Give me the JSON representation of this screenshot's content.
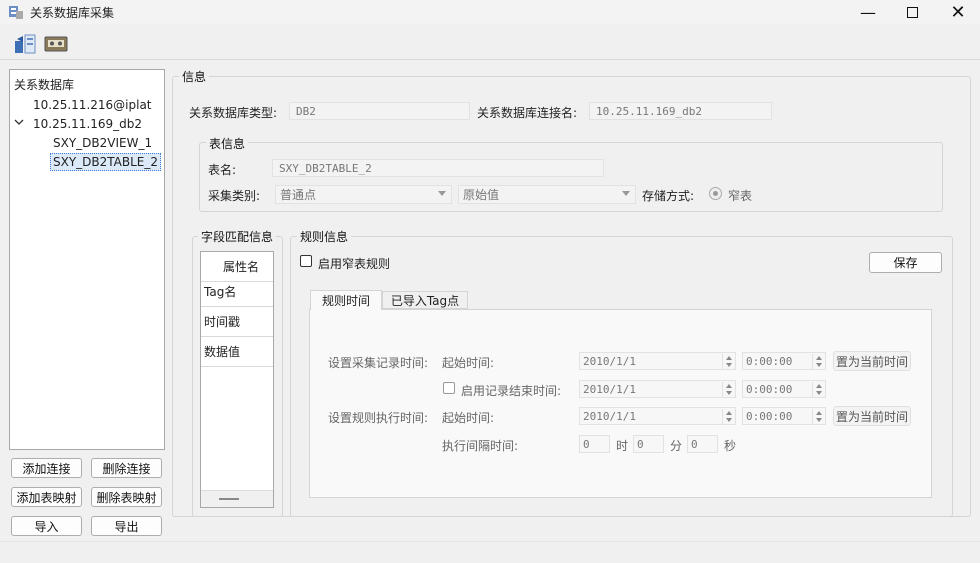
{
  "window": {
    "title": "关系数据库采集"
  },
  "toolbar": {
    "icons": [
      "database-export-icon",
      "tape-cassette-icon"
    ]
  },
  "tree": {
    "root": "关系数据库",
    "items": [
      {
        "label": "10.25.11.216@iplat",
        "expanded": false
      },
      {
        "label": "10.25.11.169_db2",
        "expanded": true
      },
      {
        "label": "SXY_DB2VIEW_1"
      },
      {
        "label": "SXY_DB2TABLE_2",
        "selected": true
      }
    ],
    "expand_glyph": "v"
  },
  "left_buttons": [
    "添加连接",
    "删除连接",
    "添加表映射",
    "删除表映射",
    "导入",
    "导出"
  ],
  "info": {
    "title": "信息",
    "db_type_label": "关系数据库类型:",
    "db_type_value": "DB2",
    "conn_name_label": "关系数据库连接名:",
    "conn_name_value": "10.25.11.169_db2",
    "table_info": {
      "title": "表信息",
      "table_name_label": "表名:",
      "table_name_value": "SXY_DB2TABLE_2",
      "collect_type_label": "采集类别:",
      "collect_type_value": "普通点",
      "value_type_value": "原始值",
      "storage_label": "存储方式:",
      "storage_option": "窄表"
    }
  },
  "field_match": {
    "title": "字段匹配信息",
    "header": "属性名",
    "rows": [
      "Tag名",
      "时间戳",
      "数据值"
    ]
  },
  "rule": {
    "title": "规则信息",
    "enable_label": "启用窄表规则",
    "save_label": "保存",
    "tabs": [
      "规则时间",
      "已导入Tag点"
    ],
    "collect_time_label": "设置采集记录时间:",
    "start_time_label": "起始时间:",
    "collect_start_date": "2010/1/1",
    "collect_start_time": "0:00:00",
    "set_now_1": "置为当前时间",
    "enable_end_label": "启用记录结束时间:",
    "end_date": "2010/1/1",
    "end_time": "0:00:00",
    "exec_time_label": "设置规则执行时间:",
    "exec_start_label": "起始时间:",
    "exec_start_date": "2010/1/1",
    "exec_start_time": "0:00:00",
    "set_now_2": "置为当前时间",
    "interval_label": "执行间隔时间:",
    "hours_value": "0",
    "hours_unit": "时",
    "minutes_value": "0",
    "minutes_unit": "分",
    "seconds_value": "0",
    "seconds_unit": "秒"
  }
}
